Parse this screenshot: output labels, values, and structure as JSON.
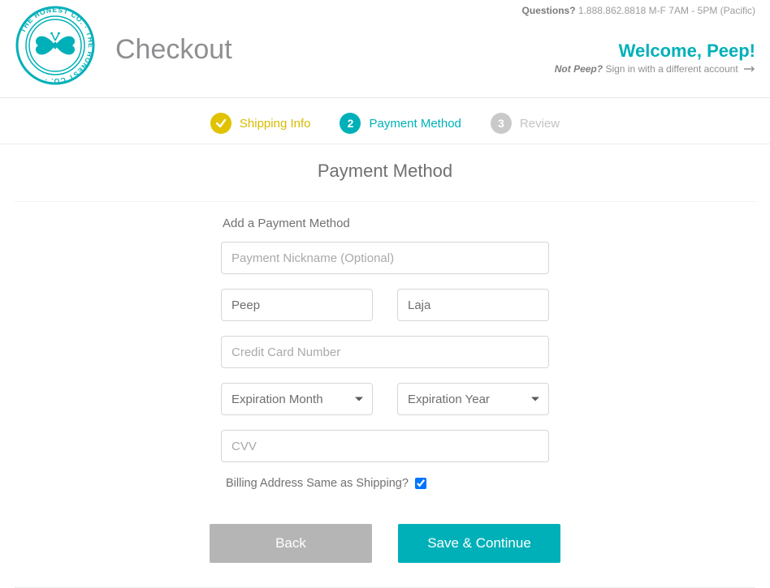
{
  "header": {
    "title": "Checkout",
    "questions_label": "Questions?",
    "questions_info": "1.888.862.8818 M-F 7AM - 5PM (Pacific)",
    "welcome": "Welcome, Peep!",
    "not_you_prefix": "Not Peep?",
    "not_you_link": "Sign in with a different account"
  },
  "steps": {
    "s1": "Shipping Info",
    "s2_num": "2",
    "s2": "Payment Method",
    "s3_num": "3",
    "s3": "Review"
  },
  "section": {
    "title": "Payment Method",
    "add_label": "Add a Payment Method"
  },
  "form": {
    "nickname_placeholder": "Payment Nickname (Optional)",
    "first_name": "Peep",
    "last_name": "Laja",
    "card_placeholder": "Credit Card Number",
    "exp_month": "Expiration Month",
    "exp_year": "Expiration Year",
    "cvv_placeholder": "CVV",
    "billing_same_label": "Billing Address Same as Shipping?"
  },
  "buttons": {
    "back": "Back",
    "continue": "Save & Continue"
  }
}
